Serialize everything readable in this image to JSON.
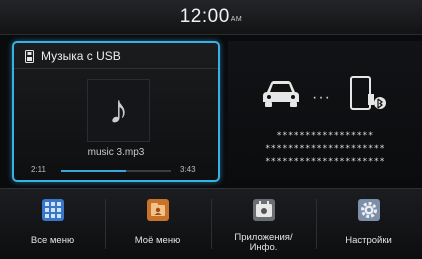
{
  "status_bar": {
    "time": "12:00",
    "ampm": "AM"
  },
  "media": {
    "source_title": "Музыка с USB",
    "track_name": "music 3.mp3",
    "elapsed": "2:11",
    "total": "3:43",
    "progress": 0.59,
    "accent_color": "#38b2e6"
  },
  "phone_panel": {
    "device_name_masked": [
      "*****************",
      "*********************",
      "*********************"
    ],
    "icons": [
      "car-icon",
      "phone-icon",
      "bluetooth-icon"
    ]
  },
  "menu": {
    "items": [
      {
        "label": "Все меню",
        "icon": "grid-icon"
      },
      {
        "label": "Моё меню",
        "icon": "folder-icon"
      },
      {
        "label": "Приложения/ Инфо.",
        "label_lines": [
          "Приложения/",
          "Инфо."
        ],
        "icon": "apps-icon"
      },
      {
        "label": "Настройки",
        "icon": "gear-icon"
      }
    ]
  }
}
